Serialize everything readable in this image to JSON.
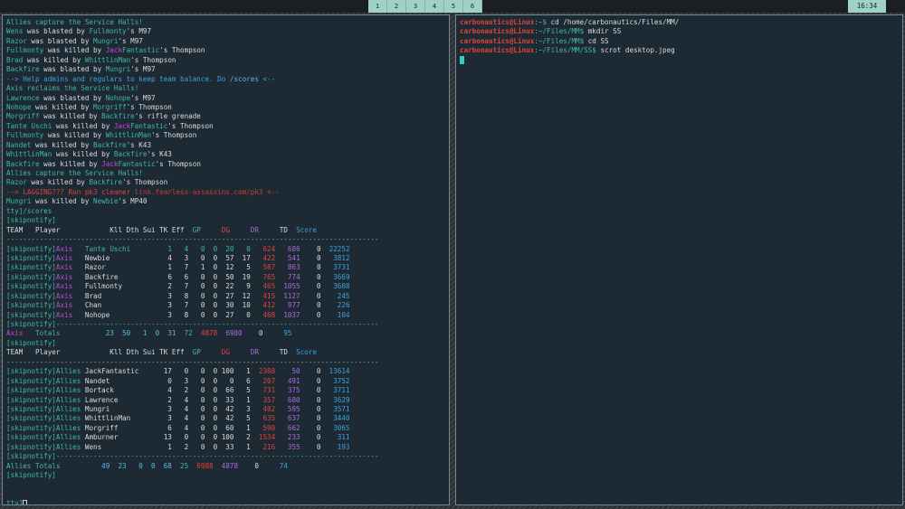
{
  "topbar": {
    "workspaces": [
      "1",
      "2",
      "3",
      "4",
      "5",
      "6"
    ],
    "clock": "16:34"
  },
  "left_terminal": {
    "feed": [
      [
        [
          "t",
          "Allies capture the Service Halls!"
        ]
      ],
      [
        [
          "t",
          "Wens"
        ],
        [
          "w",
          " was blasted by "
        ],
        [
          "t",
          "Fullmonty"
        ],
        [
          "w",
          "'s M97"
        ]
      ],
      [
        [
          "t",
          "Razor"
        ],
        [
          "w",
          " was blasted by "
        ],
        [
          "t",
          "Mungri"
        ],
        [
          "w",
          "'s M97"
        ]
      ],
      [
        [
          "t",
          "Fullmonty"
        ],
        [
          "w",
          " was killed by "
        ],
        [
          "m",
          "Jack"
        ],
        [
          "t",
          "Fantastic"
        ],
        [
          "w",
          "'s Thompson"
        ]
      ],
      [
        [
          "t",
          "Brad"
        ],
        [
          "w",
          " was killed by "
        ],
        [
          "t",
          "WhittlinMan"
        ],
        [
          "w",
          "'s Thompson"
        ]
      ],
      [
        [
          "t",
          "Backfire"
        ],
        [
          "w",
          " was blasted by "
        ],
        [
          "t",
          "Mungri"
        ],
        [
          "w",
          "'s M97"
        ]
      ],
      [
        [
          "b",
          "--> Help admins and regulars to keep team balance. Do "
        ],
        [
          "sb",
          "/scores"
        ],
        [
          "b",
          " <--"
        ]
      ],
      [
        [
          "t",
          "Axis reclaims the Service Halls!"
        ]
      ],
      [
        [
          "t",
          "Lawrence"
        ],
        [
          "w",
          " was blasted by "
        ],
        [
          "t",
          "Nohope"
        ],
        [
          "w",
          "'s M97"
        ]
      ],
      [
        [
          "t",
          "Nohope"
        ],
        [
          "w",
          " was killed by "
        ],
        [
          "t",
          "Morgriff"
        ],
        [
          "w",
          "'s Thompson"
        ]
      ],
      [
        [
          "t",
          "Morgriff"
        ],
        [
          "w",
          " was killed by "
        ],
        [
          "t",
          "Backfire"
        ],
        [
          "w",
          "'s rifle grenade"
        ]
      ],
      [
        [
          "t",
          "Tante Uschi"
        ],
        [
          "w",
          " was killed by "
        ],
        [
          "m",
          "Jack"
        ],
        [
          "t",
          "Fantastic"
        ],
        [
          "w",
          "'s Thompson"
        ]
      ],
      [
        [
          "t",
          "Fullmonty"
        ],
        [
          "w",
          " was killed by "
        ],
        [
          "t",
          "WhittlinMan"
        ],
        [
          "w",
          "'s Thompson"
        ]
      ],
      [
        [
          "t",
          "Nandet"
        ],
        [
          "w",
          " was killed by "
        ],
        [
          "t",
          "Backfire"
        ],
        [
          "w",
          "'s K43"
        ]
      ],
      [
        [
          "t",
          "WhittlinMan"
        ],
        [
          "w",
          " was killed by "
        ],
        [
          "t",
          "Backfire"
        ],
        [
          "w",
          "'s K43"
        ]
      ],
      [
        [
          "t",
          "Backfire"
        ],
        [
          "w",
          " was killed by "
        ],
        [
          "m",
          "Jack"
        ],
        [
          "t",
          "Fantastic"
        ],
        [
          "w",
          "'s Thompson"
        ]
      ],
      [
        [
          "t",
          "Allies capture the Service Halls!"
        ]
      ],
      [
        [
          "t",
          "Razor"
        ],
        [
          "w",
          " was killed by "
        ],
        [
          "t",
          "Backfire"
        ],
        [
          "w",
          "'s Thompson"
        ]
      ],
      [
        [
          "r",
          "--> LAGGING??? Run pk3 cleaner "
        ],
        [
          "lnk",
          "link.fearless-assassins.com/pk3"
        ],
        [
          "r",
          " <--"
        ]
      ],
      [
        [
          "t",
          "Mungri"
        ],
        [
          "w",
          " was killed by "
        ],
        [
          "t",
          "Newbie"
        ],
        [
          "w",
          "'s MP40"
        ]
      ],
      [
        [
          "t",
          "tty]/scores"
        ]
      ],
      [
        [
          "t",
          "[skipnotify]"
        ]
      ],
      [
        [
          "w",
          "TEAM   Player            Kll Dth Sui TK Eff  "
        ],
        [
          "t",
          "GP     "
        ],
        [
          "r",
          "DG     "
        ],
        [
          "pur",
          "DR     "
        ],
        [
          "w",
          "TD  "
        ],
        [
          "b",
          "Score"
        ]
      ],
      [
        [
          "g",
          "------------------------------------------------------------------------------------------"
        ]
      ],
      [
        [
          "t",
          "[skipnotify]"
        ],
        [
          "m",
          "Axis"
        ],
        [
          "t",
          "   Tante Uschi         1   4   0  0  20   0   "
        ],
        [
          "r",
          "624   "
        ],
        [
          "pur",
          "686    "
        ],
        [
          "w",
          "0  "
        ],
        [
          "b",
          "22252"
        ]
      ],
      [
        [
          "t",
          "[skipnotify]"
        ],
        [
          "m",
          "Axis"
        ],
        [
          "w",
          "   Newbie              4   3   0  0  57  17   "
        ],
        [
          "r",
          "422   "
        ],
        [
          "pur",
          "541    "
        ],
        [
          "w",
          "0   "
        ],
        [
          "b",
          "3812"
        ]
      ],
      [
        [
          "t",
          "[skipnotify]"
        ],
        [
          "m",
          "Axis"
        ],
        [
          "w",
          "   Razor               1   7   1  0  12   5   "
        ],
        [
          "r",
          "587   "
        ],
        [
          "pur",
          "863    "
        ],
        [
          "w",
          "0   "
        ],
        [
          "b",
          "3731"
        ]
      ],
      [
        [
          "t",
          "[skipnotify]"
        ],
        [
          "m",
          "Axis"
        ],
        [
          "w",
          "   Backfire            6   6   0  0  50  19   "
        ],
        [
          "r",
          "765   "
        ],
        [
          "pur",
          "774    "
        ],
        [
          "w",
          "0   "
        ],
        [
          "b",
          "3669"
        ]
      ],
      [
        [
          "t",
          "[skipnotify]"
        ],
        [
          "m",
          "Axis"
        ],
        [
          "w",
          "   Fullmonty           2   7   0  0  22   9   "
        ],
        [
          "r",
          "465  "
        ],
        [
          "pur",
          "1055    "
        ],
        [
          "w",
          "0   "
        ],
        [
          "b",
          "3608"
        ]
      ],
      [
        [
          "t",
          "[skipnotify]"
        ],
        [
          "m",
          "Axis"
        ],
        [
          "w",
          "   Brad                3   8   0  0  27  12   "
        ],
        [
          "r",
          "415  "
        ],
        [
          "pur",
          "1127    "
        ],
        [
          "w",
          "0    "
        ],
        [
          "b",
          "245"
        ]
      ],
      [
        [
          "t",
          "[skipnotify]"
        ],
        [
          "m",
          "Axis"
        ],
        [
          "w",
          "   Chan                3   7   0  0  30  10   "
        ],
        [
          "r",
          "412   "
        ],
        [
          "pur",
          "977    "
        ],
        [
          "w",
          "0    "
        ],
        [
          "b",
          "226"
        ]
      ],
      [
        [
          "t",
          "[skipnotify]"
        ],
        [
          "m",
          "Axis"
        ],
        [
          "w",
          "   Nohope              3   8   0  0  27   0   "
        ],
        [
          "r",
          "468  "
        ],
        [
          "pur",
          "1037    "
        ],
        [
          "w",
          "0    "
        ],
        [
          "b",
          "104"
        ]
      ],
      [
        [
          "t",
          "[skipnotify]------------------------------------------------------------------------------"
        ]
      ],
      [
        [
          "m",
          "Axis"
        ],
        [
          "t",
          "   Totals           "
        ],
        [
          "sb",
          "23  50   1  0  31  "
        ],
        [
          "t",
          "72  "
        ],
        [
          "r",
          "4878  "
        ],
        [
          "pur",
          "6980    "
        ],
        [
          "w",
          "0     "
        ],
        [
          "b",
          "95"
        ]
      ],
      [
        [
          "t",
          "[skipnotify]"
        ]
      ],
      [
        [
          "w",
          "TEAM   Player            Kll Dth Sui TK Eff  "
        ],
        [
          "t",
          "GP     "
        ],
        [
          "r",
          "DG     "
        ],
        [
          "pur",
          "DR     "
        ],
        [
          "w",
          "TD  "
        ],
        [
          "b",
          "Score"
        ]
      ],
      [
        [
          "g",
          "------------------------------------------------------------------------------------------"
        ]
      ],
      [
        [
          "t",
          "[skipnotify]Allies"
        ],
        [
          "w",
          " JackFantastic      17   0   0  0 100   1  "
        ],
        [
          "r",
          "2388    "
        ],
        [
          "pur",
          "50    "
        ],
        [
          "w",
          "0  "
        ],
        [
          "b",
          "13614"
        ]
      ],
      [
        [
          "t",
          "[skipnotify]Allies"
        ],
        [
          "w",
          " Nandet              0   3   0  0   0   6   "
        ],
        [
          "r",
          "207   "
        ],
        [
          "pur",
          "491    "
        ],
        [
          "w",
          "0   "
        ],
        [
          "b",
          "3752"
        ]
      ],
      [
        [
          "t",
          "[skipnotify]Allies"
        ],
        [
          "w",
          " Bortack             4   2   0  0  66   5   "
        ],
        [
          "r",
          "731   "
        ],
        [
          "pur",
          "375    "
        ],
        [
          "w",
          "0   "
        ],
        [
          "b",
          "3711"
        ]
      ],
      [
        [
          "t",
          "[skipnotify]Allies"
        ],
        [
          "w",
          " Lawrence            2   4   0  0  33   1   "
        ],
        [
          "r",
          "357   "
        ],
        [
          "pur",
          "680    "
        ],
        [
          "w",
          "0   "
        ],
        [
          "b",
          "3629"
        ]
      ],
      [
        [
          "t",
          "[skipnotify]Allies"
        ],
        [
          "w",
          " Mungri              3   4   0  0  42   3   "
        ],
        [
          "r",
          "402   "
        ],
        [
          "pur",
          "595    "
        ],
        [
          "w",
          "0   "
        ],
        [
          "b",
          "3571"
        ]
      ],
      [
        [
          "t",
          "[skipnotify]Allies"
        ],
        [
          "w",
          " WhittlinMan         3   4   0  0  42   5   "
        ],
        [
          "r",
          "635   "
        ],
        [
          "pur",
          "637    "
        ],
        [
          "w",
          "0   "
        ],
        [
          "b",
          "3440"
        ]
      ],
      [
        [
          "t",
          "[skipnotify]Allies"
        ],
        [
          "w",
          " Morgriff            6   4   0  0  60   1   "
        ],
        [
          "r",
          "590   "
        ],
        [
          "pur",
          "662    "
        ],
        [
          "w",
          "0   "
        ],
        [
          "b",
          "3065"
        ]
      ],
      [
        [
          "t",
          "[skipnotify]Allies"
        ],
        [
          "w",
          " Amburner           13   0   0  0 100   2  "
        ],
        [
          "r",
          "1534   "
        ],
        [
          "pur",
          "233    "
        ],
        [
          "w",
          "0    "
        ],
        [
          "b",
          "311"
        ]
      ],
      [
        [
          "t",
          "[skipnotify]Allies"
        ],
        [
          "w",
          " Wens                1   2   0  0  33   1   "
        ],
        [
          "r",
          "216   "
        ],
        [
          "pur",
          "355    "
        ],
        [
          "w",
          "0    "
        ],
        [
          "b",
          "193"
        ]
      ],
      [
        [
          "t",
          "[skipnotify]------------------------------------------------------------------------------"
        ]
      ],
      [
        [
          "t",
          "Allies Totals          "
        ],
        [
          "sb",
          "49  23   0  0  68  "
        ],
        [
          "t",
          "25  "
        ],
        [
          "r",
          "6988  "
        ],
        [
          "pur",
          "4878    "
        ],
        [
          "w",
          "0     "
        ],
        [
          "b",
          "74"
        ]
      ],
      [
        [
          "t",
          "[skipnotify]"
        ]
      ],
      [
        [
          "w",
          ""
        ]
      ],
      [
        [
          "w",
          ""
        ]
      ],
      [
        [
          "t",
          "tty]"
        ]
      ]
    ]
  },
  "right_terminal": {
    "prompt_user": "carbonautics@Linux",
    "lines": [
      {
        "path": ":~$ ",
        "cmd": "cd /home/carbonautics/Files/MM/"
      },
      {
        "path": ":~/Files/MM$ ",
        "cmd": "mkdir SS"
      },
      {
        "path": ":~/Files/MM$ ",
        "cmd": "cd SS"
      },
      {
        "path": ":~/Files/MM/SS$ ",
        "cmd": "scrot desktop.jpeg"
      }
    ]
  },
  "colors": {
    "terminal_bg": "#1e2a33",
    "teal_text": "#3fb8a8",
    "axis_magenta": "#c04ad8",
    "dg_red": "#e0423a",
    "dr_purple": "#a86ae0",
    "score_blue": "#3aa3e0",
    "workspace_bg": "#9fd1c6"
  }
}
